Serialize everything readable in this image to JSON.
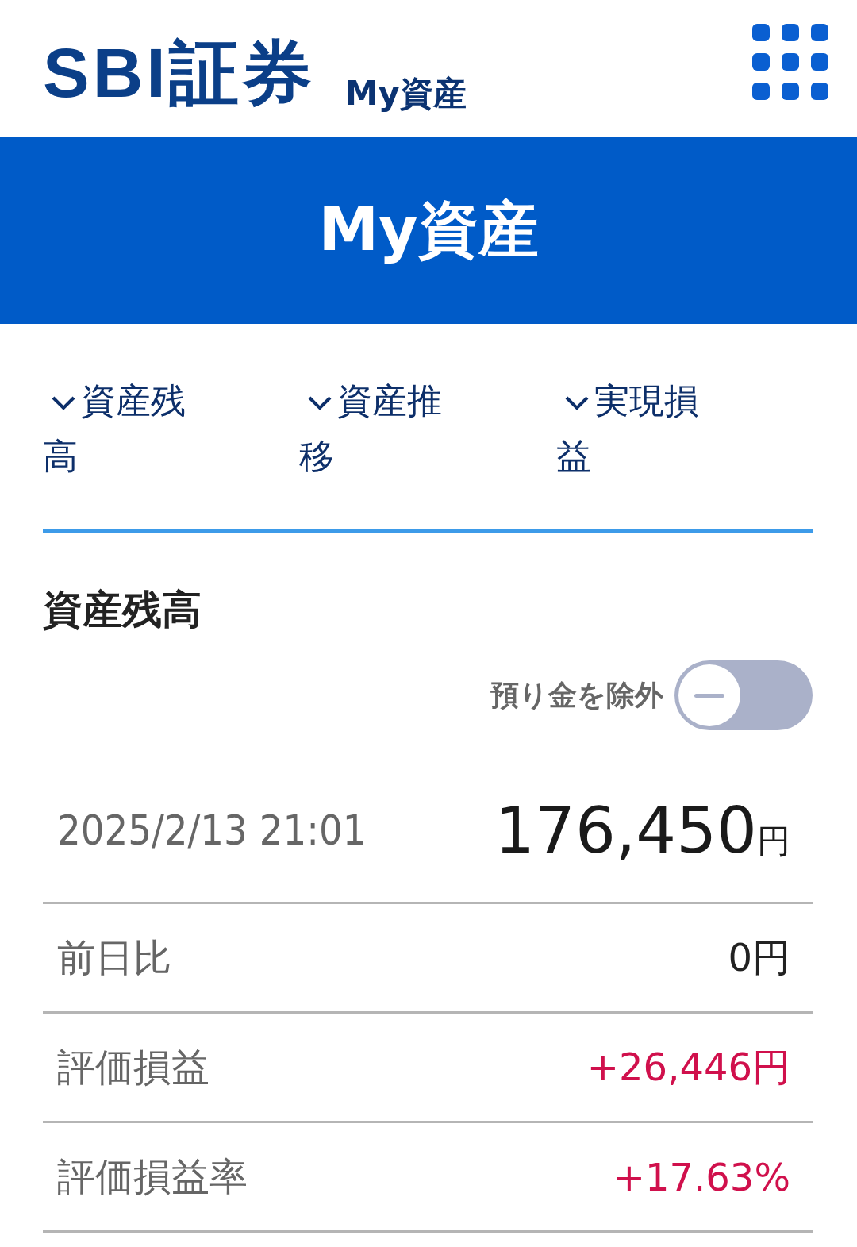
{
  "header": {
    "logo": "SBI証券",
    "subtitle": "My資産"
  },
  "banner": {
    "title": "My資産"
  },
  "tabs": [
    {
      "label": "資産残高"
    },
    {
      "label": "資産推移"
    },
    {
      "label": "実現損益"
    }
  ],
  "section": {
    "title": "資産残高",
    "toggle": {
      "label": "預り金を除外",
      "on": false
    }
  },
  "total": {
    "date": "2025/2/13 21:01",
    "amount": "176,450",
    "unit": "円"
  },
  "rows": [
    {
      "label": "前日比",
      "value": "0円",
      "kind": "plain"
    },
    {
      "label": "評価損益",
      "value": "+26,446円",
      "kind": "gain"
    },
    {
      "label": "評価損益率",
      "value": "+17.63%",
      "kind": "gain"
    }
  ]
}
